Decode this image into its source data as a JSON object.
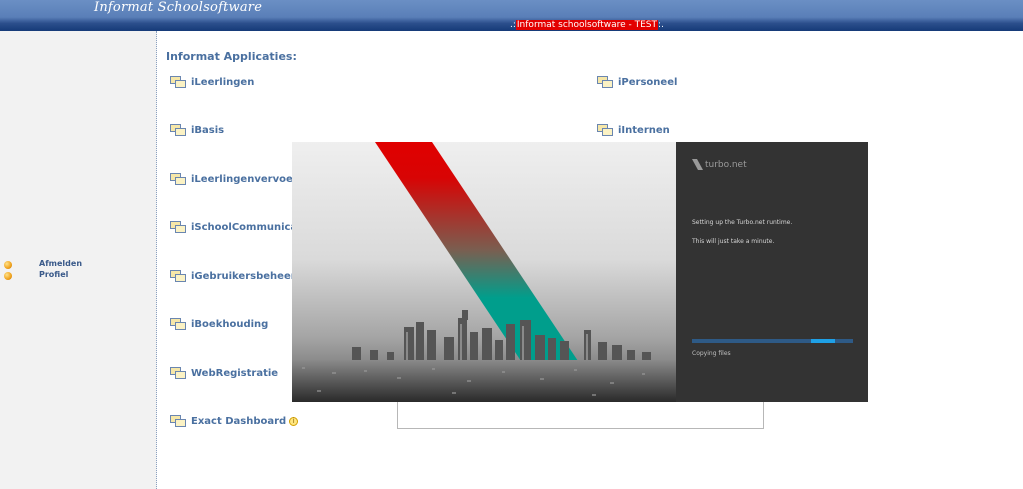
{
  "header": {
    "app_title": "Informat Schoolsoftware",
    "env_prefix": ".:",
    "env_label": "Informat schoolsoftware - TEST",
    "env_suffix": ":."
  },
  "sidebar": {
    "links": [
      {
        "label": "Afmelden"
      },
      {
        "label": "Profiel"
      }
    ]
  },
  "main": {
    "section_title": "Informat Applicaties:",
    "apps_left": [
      {
        "label": "iLeerlingen"
      },
      {
        "label": "iBasis"
      },
      {
        "label": "iLeerlingenvervoer"
      },
      {
        "label": "iSchoolCommunicatie"
      },
      {
        "label": "iGebruikersbeheer"
      },
      {
        "label": "iBoekhouding"
      },
      {
        "label": "WebRegistratie"
      },
      {
        "label": "Exact Dashboard"
      }
    ],
    "apps_right": [
      {
        "label": "iPersoneel"
      },
      {
        "label": "iInternen"
      }
    ]
  },
  "turbo_dialog": {
    "logo_text": "turbo.net",
    "message_1": "Setting up the Turbo.net runtime.",
    "message_2": "This will just take a minute.",
    "progress_label": "Copying files",
    "progress_fraction": 0.89,
    "colors": {
      "stripe_top": "#e00000",
      "stripe_bottom": "#009e8c",
      "panel": "#333333",
      "progress": "#1ea0e6"
    }
  }
}
